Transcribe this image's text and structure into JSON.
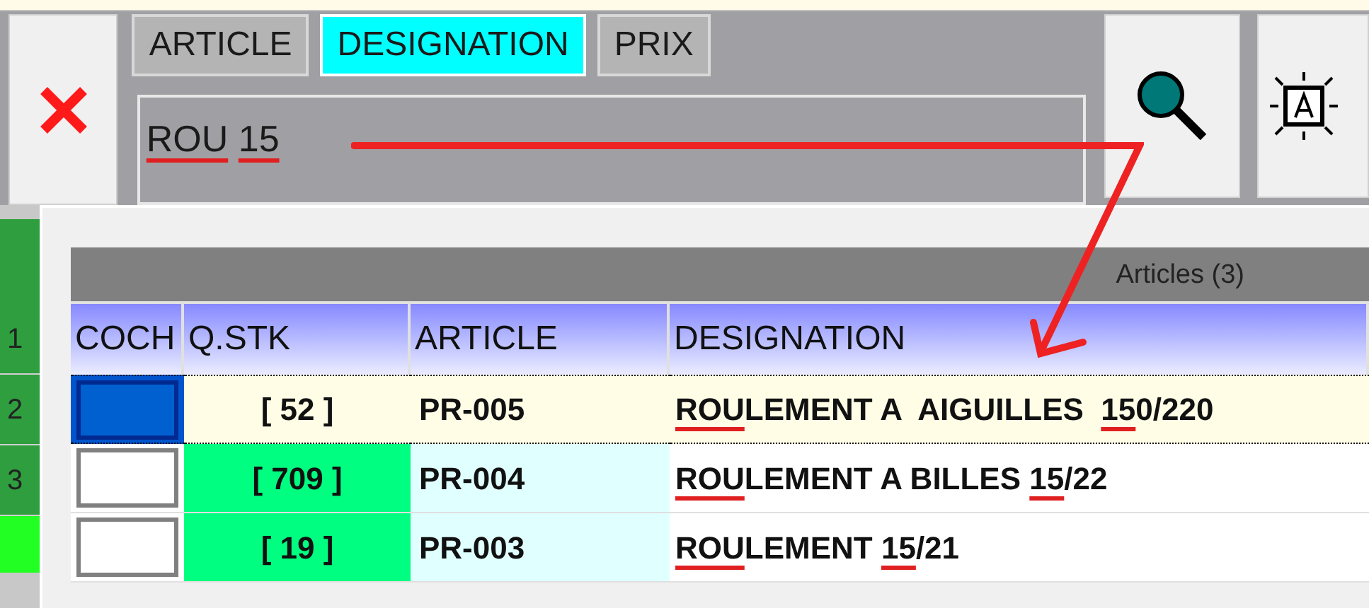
{
  "tabs": [
    {
      "label": "ARTICLE",
      "selected": false
    },
    {
      "label": "DESIGNATION",
      "selected": true
    },
    {
      "label": "PRIX",
      "selected": false
    }
  ],
  "search": {
    "value": [
      {
        "text": "ROU",
        "marked": true
      },
      {
        "text": "15",
        "marked": true
      }
    ]
  },
  "side_rows": [
    "1",
    "2",
    "3"
  ],
  "grid": {
    "title": "Articles (3)",
    "columns": [
      "COCH",
      "Q.STK",
      "ARTICLE",
      "DESIGNATION"
    ],
    "rows": [
      {
        "selected": true,
        "checked": true,
        "qty": "[ 52 ]",
        "article": "PR-005",
        "designation": [
          {
            "text": "ROU",
            "marked": true
          },
          {
            "text": "LEMENT A  AIGUILLES  ",
            "marked": false
          },
          {
            "text": "15",
            "marked": true
          },
          {
            "text": "0/220",
            "marked": false
          }
        ]
      },
      {
        "selected": false,
        "checked": false,
        "qty": "[ 709 ]",
        "article": "PR-004",
        "designation": [
          {
            "text": "ROU",
            "marked": true
          },
          {
            "text": "LEMENT A BILLES ",
            "marked": false
          },
          {
            "text": "15",
            "marked": true
          },
          {
            "text": "/22",
            "marked": false
          }
        ]
      },
      {
        "selected": false,
        "checked": false,
        "qty": "[ 19 ]",
        "article": "PR-003",
        "designation": [
          {
            "text": "ROU",
            "marked": true
          },
          {
            "text": "LEMENT ",
            "marked": false
          },
          {
            "text": "15",
            "marked": true
          },
          {
            "text": "/21",
            "marked": false
          }
        ]
      }
    ]
  }
}
